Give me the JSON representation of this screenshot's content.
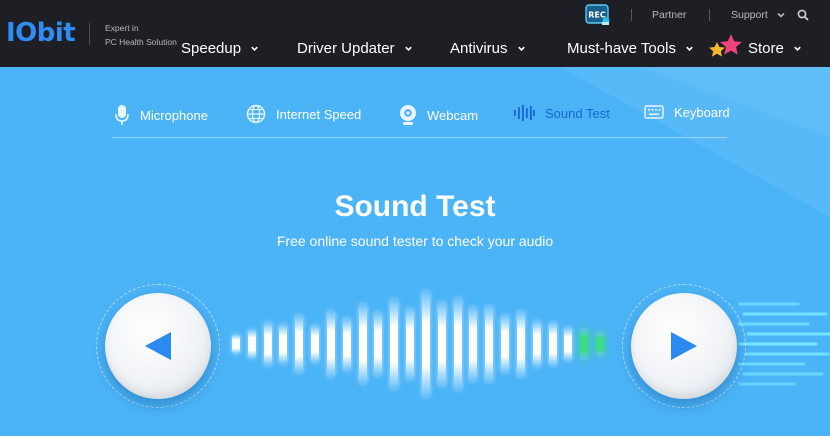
{
  "header": {
    "logo": "IObit",
    "tagline_line1": "Expert in",
    "tagline_line2": "PC Health Solution",
    "utility": {
      "partner": "Partner",
      "support": "Support"
    },
    "menu": [
      "Speedup",
      "Driver Updater",
      "Antivirus",
      "Must-have Tools",
      "Store"
    ]
  },
  "tabs": [
    {
      "label": "Microphone",
      "icon": "microphone-icon",
      "active": false
    },
    {
      "label": "Internet Speed",
      "icon": "globe-icon",
      "active": false
    },
    {
      "label": "Webcam",
      "icon": "webcam-icon",
      "active": false
    },
    {
      "label": "Sound Test",
      "icon": "sound-wave-icon",
      "active": true
    },
    {
      "label": "Keyboard",
      "icon": "keyboard-icon",
      "active": false
    }
  ],
  "hero": {
    "title": "Sound Test",
    "subtitle": "Free online sound tester to check your audio"
  },
  "player": {
    "left_icon": "speaker-left-icon",
    "right_icon": "speaker-right-icon",
    "wave_levels": [
      0.18,
      0.28,
      0.42,
      0.38,
      0.55,
      0.35,
      0.62,
      0.5,
      0.75,
      0.6,
      0.85,
      0.68,
      1.0,
      0.8,
      0.86,
      0.7,
      0.72,
      0.55,
      0.62,
      0.44,
      0.42,
      0.32,
      0.3,
      0.22
    ],
    "active_bars": 2,
    "colors": {
      "bar": "#ffffff",
      "active": "#3ddc84",
      "arrow": "#2a8af0",
      "topbar": "#1e1f24",
      "background": "#4bb4f7"
    }
  }
}
